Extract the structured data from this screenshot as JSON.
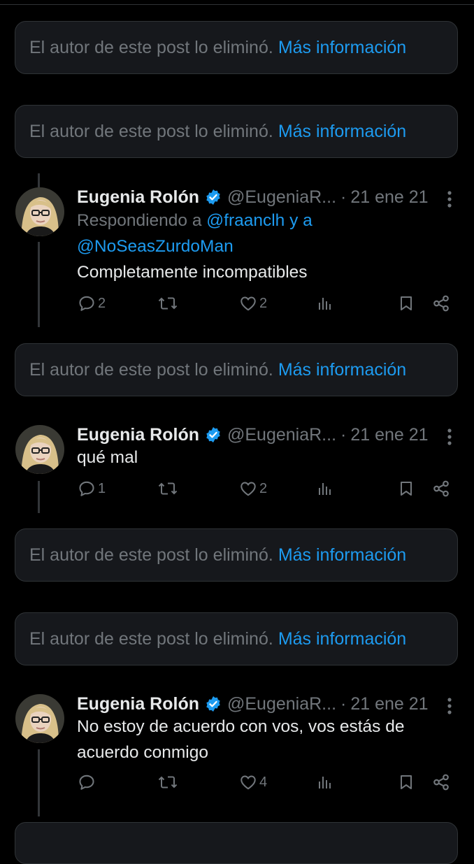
{
  "deleted_notice": {
    "text": "El autor de este post lo eliminó.",
    "link": "Más información"
  },
  "author": {
    "name": "Eugenia Rolón",
    "handle": "@EugeniaR...",
    "date": "21 ene 21"
  },
  "tweets": [
    {
      "reply_prefix": "Respondiendo a ",
      "reply_user1": "@fraanclh",
      "reply_join": " y a",
      "reply_user2": "@NoSeasZurdoMan",
      "text": "Completamente incompatibles",
      "replies": "2",
      "likes": "2"
    },
    {
      "text": "qué mal",
      "replies": "1",
      "likes": "2"
    },
    {
      "text": "No estoy de acuerdo con vos, vos estás de acuerdo conmigo",
      "replies": "",
      "likes": "4"
    }
  ],
  "icons": {
    "reply": "reply-icon",
    "retweet": "retweet-icon",
    "like": "heart-icon",
    "views": "views-icon",
    "bookmark": "bookmark-icon",
    "share": "share-icon",
    "verified": "verified-badge-icon",
    "more": "more-options-icon"
  },
  "colors": {
    "accent": "#1d9bf0",
    "muted": "#71767b",
    "card": "#16181c",
    "background": "#000000"
  }
}
